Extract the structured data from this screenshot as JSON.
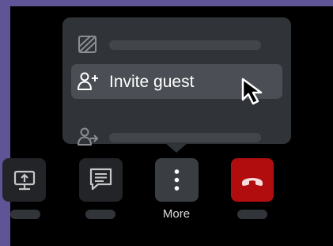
{
  "menu": {
    "items": [
      {
        "icon": "slash-square-icon",
        "label": ""
      },
      {
        "icon": "add-user-icon",
        "label": "Invite guest",
        "highlighted": true
      },
      {
        "icon": "user-forward-icon",
        "label": ""
      }
    ]
  },
  "toolbar": {
    "buttons": [
      {
        "icon": "share-screen-icon",
        "label": ""
      },
      {
        "icon": "chat-icon",
        "label": ""
      },
      {
        "icon": "more-vertical-icon",
        "label": "More"
      },
      {
        "icon": "hang-up-icon",
        "label": ""
      }
    ]
  },
  "colors": {
    "frame": "#5e5496",
    "menu_bg": "#303438",
    "menu_highlight": "#4b4f55",
    "hangup": "#b10d0f",
    "placeholder": "#42464b"
  }
}
